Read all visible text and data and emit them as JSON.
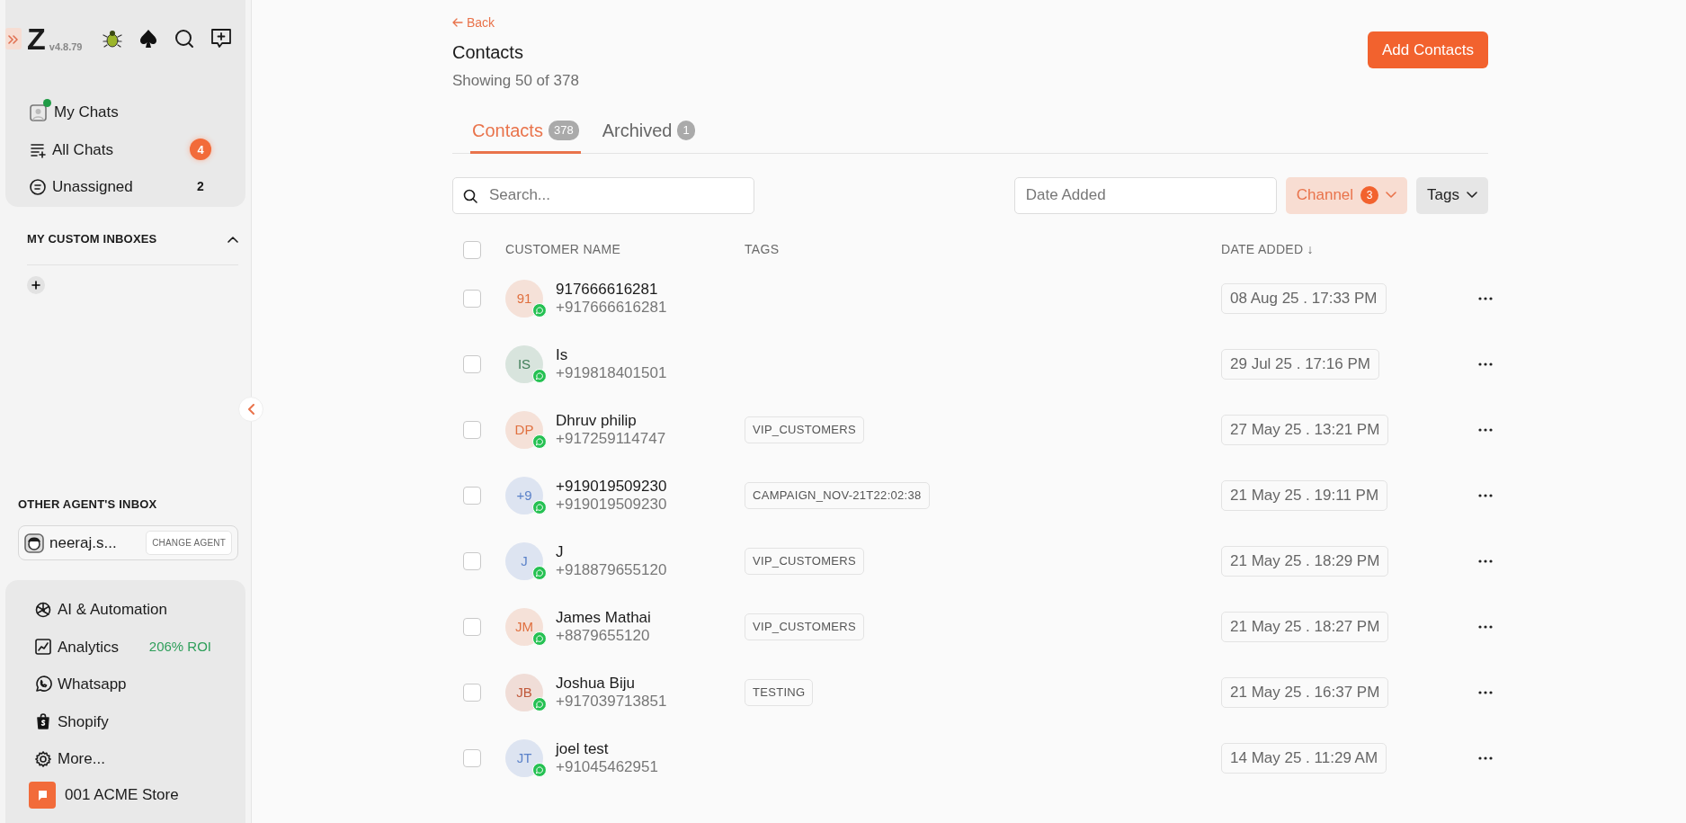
{
  "sidebar": {
    "logo": "Z",
    "version": "v4.8.79",
    "nav": [
      {
        "label": "My Chats",
        "online": true
      },
      {
        "label": "All Chats",
        "count": "4",
        "highlight": true
      },
      {
        "label": "Unassigned",
        "count": "2",
        "highlight": false
      }
    ],
    "custom_inboxes": {
      "title": "MY CUSTOM INBOXES",
      "expanded": true
    },
    "other_agent": {
      "title": "OTHER AGENT'S INBOX",
      "agent": "neeraj.s...",
      "button": "CHANGE AGENT"
    },
    "apps": [
      {
        "label": "AI & Automation"
      },
      {
        "label": "Analytics",
        "note": "206% ROI"
      },
      {
        "label": "Whatsapp"
      },
      {
        "label": "Shopify"
      },
      {
        "label": "More..."
      }
    ],
    "store": "001 ACME Store"
  },
  "main": {
    "back": "Back",
    "title": "Contacts",
    "subtitle": "Showing 50 of 378",
    "add_button": "Add Contacts",
    "tabs": [
      {
        "label": "Contacts",
        "count": "378",
        "selected": true
      },
      {
        "label": "Archived",
        "count": "1",
        "selected": false
      }
    ],
    "search": {
      "placeholder": "Search..."
    },
    "date_filter": {
      "placeholder": "Date Added"
    },
    "filters": [
      {
        "label": "Channel",
        "count": "3",
        "active": true
      },
      {
        "label": "Tags",
        "active": false
      }
    ],
    "table": {
      "all_checked": false,
      "columns": [
        {
          "label": "CUSTOMER NAME"
        },
        {
          "label": "TAGS"
        },
        {
          "label": "DATE ADDED ↓"
        }
      ],
      "rows": [
        {
          "initials": "91",
          "color": "#e0703f",
          "name": "917666616281",
          "phone": "+917666616281",
          "date": "08 Aug 25 . 17:33 PM",
          "checked": false
        },
        {
          "initials": "IS",
          "color": "#3f7d57",
          "name": "Is",
          "phone": "+919818401501",
          "date": "29 Jul 25 . 17:16 PM",
          "checked": false
        },
        {
          "initials": "DP",
          "color": "#e0703f",
          "name": "Dhruv philip",
          "phone": "+917259114747",
          "tags": [
            "VIP_CUSTOMERS"
          ],
          "date": "27 May 25 . 13:21 PM",
          "checked": false
        },
        {
          "initials": "+9",
          "color": "#5b82c9",
          "name": "+919019509230",
          "phone": "+919019509230",
          "tags": [
            "CAMPAIGN_NOV-21T22:02:38"
          ],
          "date": "21 May 25 . 19:11 PM",
          "checked": false
        },
        {
          "initials": "J",
          "color": "#5b82c9",
          "name": "J",
          "phone": "+918879655120",
          "tags": [
            "VIP_CUSTOMERS"
          ],
          "date": "21 May 25 . 18:29 PM",
          "checked": false
        },
        {
          "initials": "JM",
          "color": "#e0703f",
          "name": "James Mathai",
          "phone": "+8879655120",
          "tags": [
            "VIP_CUSTOMERS"
          ],
          "date": "21 May 25 . 18:27 PM",
          "checked": false
        },
        {
          "initials": "JB",
          "color": "#c0583a",
          "name": "Joshua Biju",
          "phone": "+917039713851",
          "tags": [
            "TESTING"
          ],
          "date": "21 May 25 . 16:37 PM",
          "checked": false
        },
        {
          "initials": "JT",
          "color": "#5b82c9",
          "name": "joel test",
          "phone": "+91045462951",
          "date": "14 May 25 . 11:29 AM",
          "checked": false
        }
      ]
    }
  }
}
